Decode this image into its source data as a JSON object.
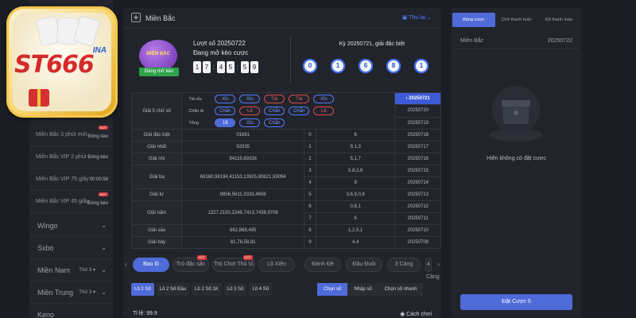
{
  "logo": {
    "brand": "ST666",
    "sub": "INA"
  },
  "sidebar": {
    "items": [
      {
        "label": "Miền Bắc 3 phút mới",
        "time": "Đóng kèo",
        "hot": "HOT"
      },
      {
        "label": "Miền Bắc VIP 2 phút",
        "time": "Đóng kèo",
        "hot": ""
      },
      {
        "label": "Miền Bắc VIP 75 giây",
        "time": "00:00:58",
        "hot": ""
      },
      {
        "label": "Miền Bắc VIP 45 giây",
        "time": "Đóng kèo",
        "hot": "HOT"
      }
    ],
    "groups": [
      {
        "label": "Wingo",
        "thu": ""
      },
      {
        "label": "Sxbo",
        "thu": ""
      },
      {
        "label": "Miền Nam",
        "thu": "Thứ 3 ▾"
      },
      {
        "label": "Miền Trung",
        "thu": "Thứ 3 ▾"
      },
      {
        "label": "Keno",
        "thu": ""
      }
    ]
  },
  "header": {
    "title": "Miền Bắc",
    "rules": "Thu lại"
  },
  "draw": {
    "icon_label": "MIỀN BẮC",
    "badge": "Đang mở kèo",
    "turn_label": "Lượt số 20250722",
    "turn_sub": "Đang mở kèo cược",
    "timer": [
      "1",
      "7",
      "4",
      "5",
      "5",
      "9"
    ],
    "last_label": "Kỳ 20250721, giải đặc biệt",
    "balls": [
      "0",
      "1",
      "6",
      "8",
      "1"
    ]
  },
  "table": {
    "giai5": "Giải 5 chữ số",
    "tags": [
      {
        "key": "Tài xỉu",
        "pills": [
          {
            "t": "Xỉu",
            "c": "blue"
          },
          {
            "t": "Xỉu",
            "c": "blue"
          },
          {
            "t": "Tài",
            "c": "red"
          },
          {
            "t": "Tài",
            "c": "red"
          },
          {
            "t": "Xỉu",
            "c": "blue"
          }
        ]
      },
      {
        "key": "Chẵn lẻ",
        "pills": [
          {
            "t": "Chẵn",
            "c": "blue"
          },
          {
            "t": "Lẻ",
            "c": "red"
          },
          {
            "t": "Chẵn",
            "c": "blue"
          },
          {
            "t": "Chẵn",
            "c": "blue"
          },
          {
            "t": "Lẻ",
            "c": "red"
          }
        ]
      },
      {
        "key": "Tổng",
        "pills": [
          {
            "t": "16",
            "c": "sel"
          },
          {
            "t": "Xỉu",
            "c": "blue"
          },
          {
            "t": "Chẵn",
            "c": "blue"
          }
        ]
      }
    ],
    "rows": [
      {
        "name": "Giải đặc biệt",
        "val": "01681",
        "blue": "",
        "idx": "0",
        "tail": "6"
      },
      {
        "name": "Giải nhất",
        "val": "53335",
        "blue": "",
        "idx": "1",
        "tail": "9,1,3"
      },
      {
        "name": "Giải nhì",
        "val": "94119,89336",
        "blue": "",
        "idx": "2",
        "tail": "5,1,7"
      },
      {
        "name": "Giải ba",
        "val": "66160,98194,41153,13925,80821,59094",
        "blue": "",
        "idx": "3",
        "tail": "5,8,3,8"
      },
      {
        "name": "",
        "val": "",
        "blue": "",
        "idx": "4",
        "tail": "8"
      },
      {
        "name": "Giải tư",
        "val": "9856,5611,3333,4659",
        "blue": "",
        "idx": "5",
        "tail": "3,6,9,0,8"
      },
      {
        "name": "Giải năm",
        "val": "1327,2150,2248,7413,7438,9706",
        "blue": "",
        "idx": "6",
        "tail": "0,8,1"
      },
      {
        "name": "",
        "val": "",
        "blue": "",
        "idx": "7",
        "tail": "6"
      },
      {
        "name": "Giải sáu",
        "val": "862,868,485",
        "blue": "",
        "idx": "8",
        "tail": "1,2,5,1"
      },
      {
        "name": "Giải bảy",
        "val": "61,76,58,81",
        "blue": "",
        "idx": "9",
        "tail": "4,4"
      }
    ],
    "dates": [
      "20250721",
      "20250720",
      "20250719",
      "20250718",
      "20250717",
      "20250716",
      "20250715",
      "20250714",
      "20250713",
      "20250712",
      "20250711",
      "20250710",
      "20250709"
    ]
  },
  "tabs": [
    {
      "label": "Bao lô",
      "hot": ""
    },
    {
      "label": "Trò đặc sắc",
      "hot": "HOT"
    },
    {
      "label": "Trò Chơi Thú Vị",
      "hot": "HOT"
    },
    {
      "label": "Lô Xiên",
      "hot": ""
    },
    {
      "label": "Đánh Đề",
      "hot": ""
    },
    {
      "label": "Đầu Đuôi",
      "hot": ""
    },
    {
      "label": "3 Càng",
      "hot": ""
    },
    {
      "label": "4 Càng",
      "hot": ""
    }
  ],
  "subtabs": [
    "Lô 2 Số",
    "Lô 2 Số Đầu",
    "Lô 2 Số 1K",
    "Lô 3 Số",
    "Lô 4 Số"
  ],
  "modes": [
    "Chọn số",
    "Nhập số",
    "Chọn số nhanh"
  ],
  "odds": {
    "label": "Tỉ lệ:",
    "value": "99.9"
  },
  "howto": "Cách chơi",
  "right": {
    "tabs": [
      "Bảng cược",
      "Chờ thanh toán",
      "Đã thanh toán"
    ],
    "row_left": "Miền Bắc",
    "row_right": "20250722",
    "empty": "Hiện không có đặt cược",
    "button": "Đặt Cược 0"
  }
}
